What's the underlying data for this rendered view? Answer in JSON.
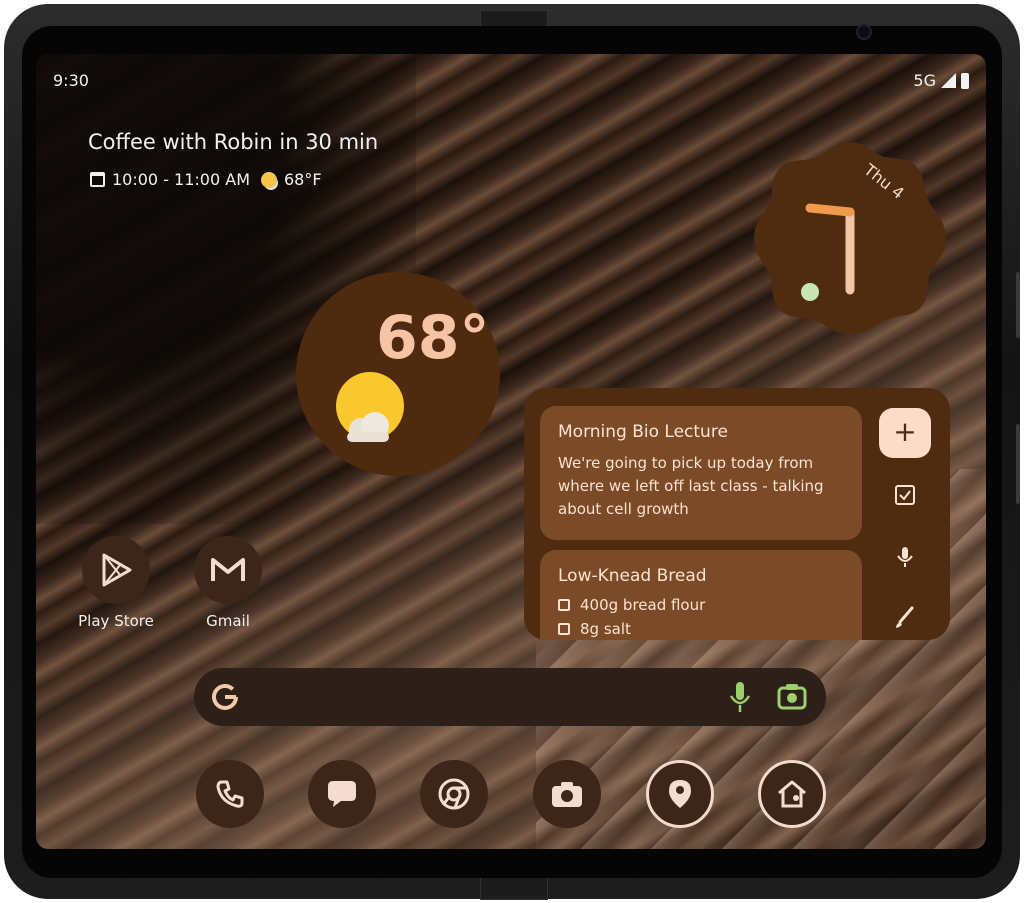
{
  "status_bar": {
    "time": "9:30",
    "network": "5G"
  },
  "at_a_glance": {
    "title": "Coffee with Robin in 30 min",
    "time_range": "10:00 - 11:00 AM",
    "temperature": "68°F"
  },
  "clock_widget": {
    "date": "Thu 4",
    "hour": 10,
    "minute": 30
  },
  "weather_widget": {
    "temperature": "68°"
  },
  "notes_widget": {
    "notes": [
      {
        "title": "Morning Bio Lecture",
        "body": "We're going to pick up today from where we left off last class - talking about cell growth"
      },
      {
        "title": "Low-Knead Bread",
        "checklist": [
          "400g bread flour",
          "8g salt"
        ]
      }
    ],
    "add_label": "+",
    "tools": [
      "checkbox-icon",
      "mic-icon",
      "brush-icon"
    ]
  },
  "home_apps": [
    {
      "label": "Play Store",
      "icon": "play-store-icon"
    },
    {
      "label": "Gmail",
      "icon": "gmail-icon"
    }
  ],
  "search_bar": {
    "logo": "google-logo-icon",
    "voice": "mic-icon",
    "lens": "camera-lens-icon"
  },
  "dock": [
    "phone-icon",
    "messages-icon",
    "chrome-icon",
    "camera-icon",
    "maps-icon",
    "home-icon"
  ],
  "colors": {
    "widget_brown": "#4f2b10",
    "note_card": "#7b4a26",
    "accent_peach": "#fbdcc7",
    "orange": "#f09a4c",
    "sun_yellow": "#f9c82c"
  }
}
